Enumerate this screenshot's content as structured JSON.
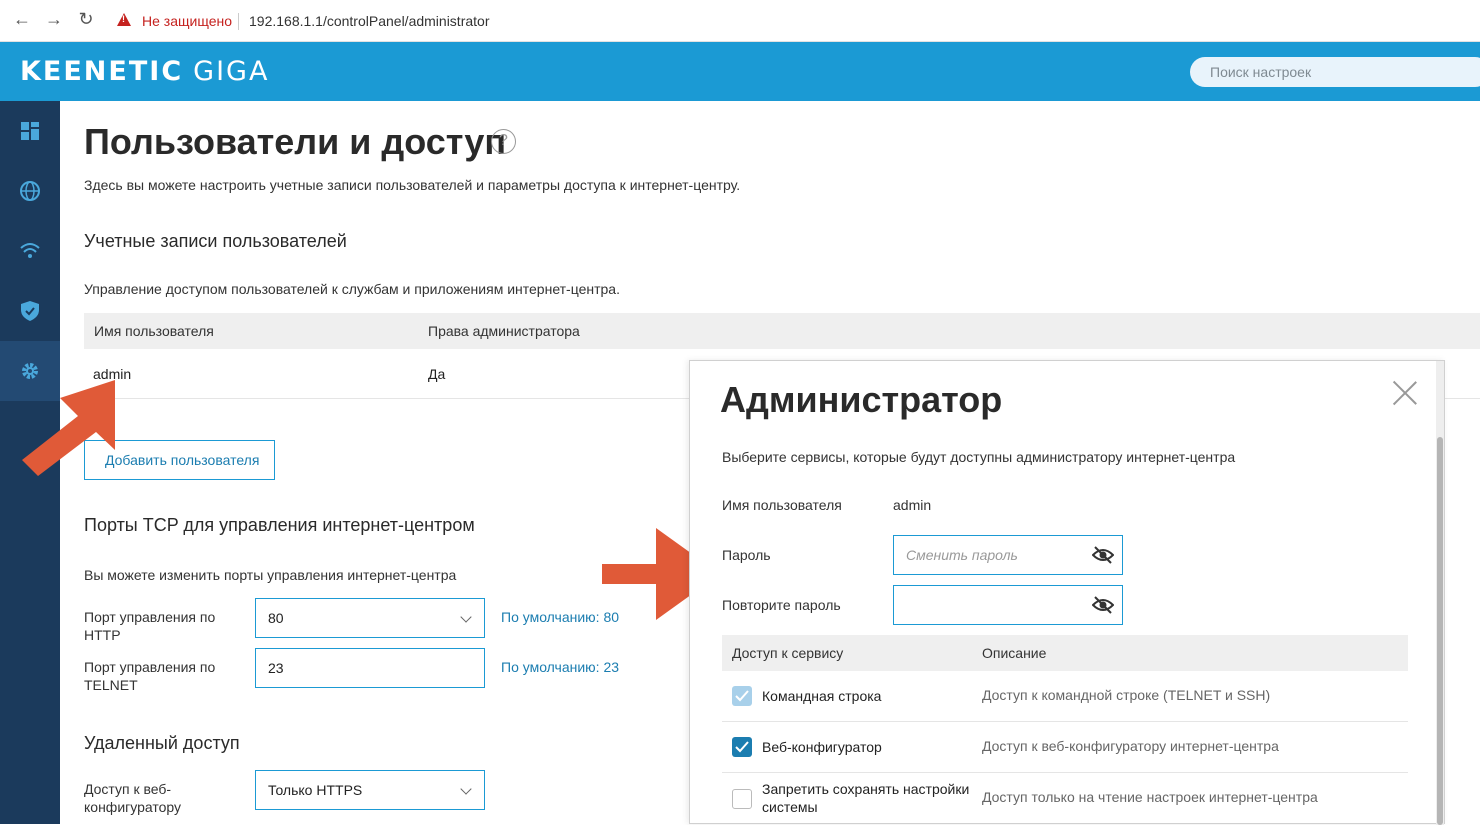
{
  "browser": {
    "insecure_label": "Не защищено",
    "url": "192.168.1.1/controlPanel/administrator"
  },
  "header": {
    "brand": "KEENETIC",
    "model": "GIGA",
    "search_placeholder": "Поиск настроек",
    "color": "#1b9ad4"
  },
  "sidebar": {
    "items": [
      {
        "icon": "dashboard-icon"
      },
      {
        "icon": "globe-icon"
      },
      {
        "icon": "wifi-icon"
      },
      {
        "icon": "shield-icon"
      },
      {
        "icon": "gear-icon",
        "active": true
      }
    ]
  },
  "page": {
    "title": "Пользователи и доступ",
    "description": "Здесь вы можете настроить учетные записи пользователей и параметры доступа к интернет-центру."
  },
  "users_section": {
    "title": "Учетные записи пользователей",
    "description": "Управление доступом пользователей к службам и приложениям интернет-центра.",
    "columns": [
      "Имя пользователя",
      "Права администратора"
    ],
    "rows": [
      [
        "admin",
        "Да"
      ]
    ],
    "add_button": "Добавить пользователя"
  },
  "ports_section": {
    "title": "Порты TCP для управления интернет-центром",
    "description": "Вы можете изменить порты управления интернет-центра",
    "http_label": "Порт управления по HTTP",
    "http_value": "80",
    "http_default": "По умолчанию: 80",
    "telnet_label": "Порт управления по TELNET",
    "telnet_value": "23",
    "telnet_default": "По умолчанию: 23"
  },
  "remote_section": {
    "title": "Удаленный доступ",
    "web_label": "Доступ к веб-конфигуратору",
    "web_value": "Только HTTPS"
  },
  "modal": {
    "title": "Администратор",
    "description": "Выберите сервисы, которые будут доступны администратору интернет-центра",
    "username_label": "Имя пользователя",
    "username_value": "admin",
    "password_label": "Пароль",
    "password_placeholder": "Сменить пароль",
    "repeat_label": "Повторите пароль",
    "services_columns": [
      "Доступ к сервису",
      "Описание"
    ],
    "services": [
      {
        "name": "Командная строка",
        "description": "Доступ к командной строке (TELNET и SSH)",
        "checked": true,
        "disabled": true
      },
      {
        "name": "Веб-конфигуратор",
        "description": "Доступ к веб-конфигуратору интернет-центра",
        "checked": true
      },
      {
        "name": "Запретить сохранять настройки системы",
        "description": "Доступ только на чтение настроек интернет-центра",
        "checked": false
      }
    ]
  }
}
